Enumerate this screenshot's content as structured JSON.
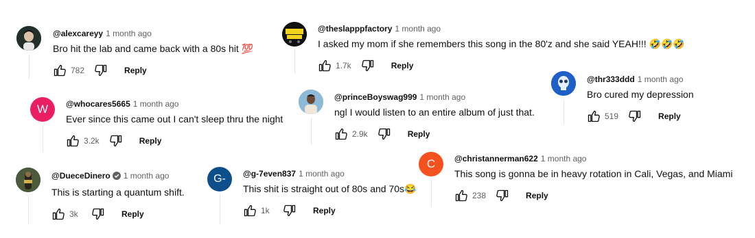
{
  "reply_label": "Reply",
  "comments": [
    {
      "handle": "@alexcareyy",
      "time": "1 month ago",
      "text": "Bro hit the lab and came back with a 80s hit 💯",
      "likes": "782"
    },
    {
      "handle": "@theslapppfactory",
      "time": "1 month ago",
      "text": "I asked my mom if she remembers this song in the 80'z and she said YEAH!!! 🤣🤣🤣",
      "likes": "1.7k",
      "avatar_text": "SLAP FACTORY"
    },
    {
      "handle": "@thr333ddd",
      "time": "1 month ago",
      "text": "Bro cured my depression",
      "likes": "519"
    },
    {
      "handle": "@whocares5665",
      "time": "1 month ago",
      "text": "Ever since this came out I can't sleep thru the night",
      "likes": "3.2k",
      "avatar_letter": "W"
    },
    {
      "handle": "@princeBoyswag999",
      "time": "1 month ago",
      "text": "ngl I would listen to an entire album of just that.",
      "likes": "2.9k"
    },
    {
      "handle": "@christannerman622",
      "time": "1 month ago",
      "text": "This song is gonna be in heavy rotation in Cali, Vegas, and Miami",
      "likes": "238",
      "avatar_letter": "C"
    },
    {
      "handle": "@DueceDinero",
      "time": "1 month ago",
      "text": "This is starting a quantum shift.",
      "likes": "3k",
      "verified": true
    },
    {
      "handle": "@g-7even837",
      "time": "1 month ago",
      "text": "This shit is straight out of 80s and 70s😂",
      "likes": "1k",
      "avatar_letter": "G-"
    }
  ],
  "colors": {
    "w_avatar": "#e91e63",
    "c_avatar": "#f4511e",
    "g_avatar": "#0d4f8b"
  },
  "icons": {
    "like": "thumb-up-icon",
    "dislike": "thumb-down-icon",
    "verified": "verified-check-icon"
  }
}
